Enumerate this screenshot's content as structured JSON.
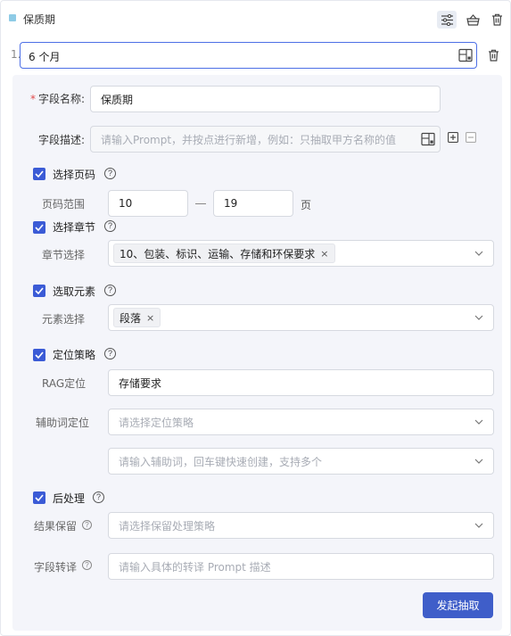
{
  "header": {
    "title": "保质期",
    "icons": [
      "sliders-icon",
      "basket-icon",
      "trash-icon"
    ]
  },
  "value_row": {
    "index": "1.",
    "value": "6 个月"
  },
  "field": {
    "name_label": "字段名称:",
    "name_value": "保质期",
    "desc_label": "字段描述:",
    "desc_placeholder": "请输入Prompt，并按点进行新增，例如：只抽取甲方名称的值"
  },
  "page_section": {
    "title": "选择页码",
    "range_label": "页码范围",
    "from": "10",
    "to": "19",
    "unit": "页"
  },
  "chapter_section": {
    "title": "选择章节",
    "select_label": "章节选择",
    "tags": [
      "10、包装、标识、运输、存储和环保要求"
    ]
  },
  "element_section": {
    "title": "选取元素",
    "select_label": "元素选择",
    "tags": [
      "段落"
    ]
  },
  "locate_section": {
    "title": "定位策略",
    "rag_label": "RAG定位",
    "rag_value": "存储要求",
    "aux_label": "辅助词定位",
    "aux_strategy_placeholder": "请选择定位策略",
    "aux_words_placeholder": "请输入辅助词，回车键快速创建，支持多个"
  },
  "post_section": {
    "title": "后处理",
    "keep_label": "结果保留",
    "keep_placeholder": "请选择保留处理策略",
    "translate_label": "字段转译",
    "translate_placeholder": "请输入具体的转译 Prompt 描述"
  },
  "actions": {
    "submit_label": "发起抽取"
  },
  "colors": {
    "primary": "#3f5ec9",
    "accent_square": "#8ecbe6",
    "required": "#e04a4a",
    "config_bg": "#f4f5fa"
  }
}
